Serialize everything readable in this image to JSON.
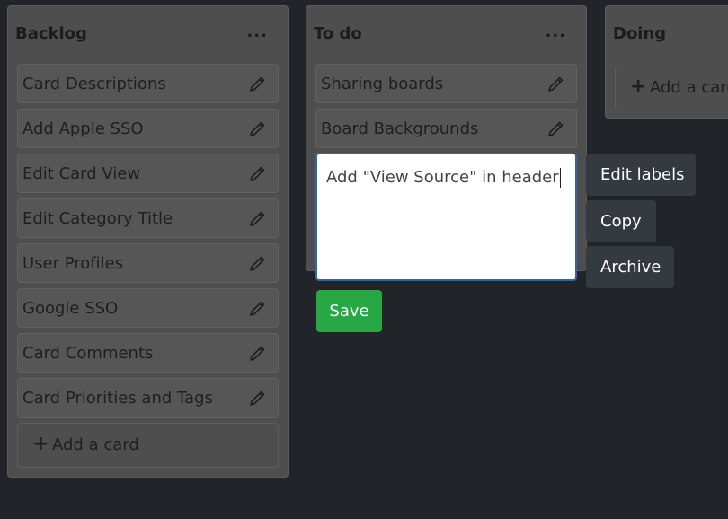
{
  "lists": [
    {
      "title": "Backlog",
      "menu_label": "...",
      "cards": [
        "Card Descriptions",
        "Add Apple SSO",
        "Edit Card View",
        "Edit Category Title",
        "User Profiles",
        "Google SSO",
        "Card Comments",
        "Card Priorities and Tags"
      ],
      "add_card_label": "Add a card"
    },
    {
      "title": "To do",
      "menu_label": "...",
      "cards": [
        "Sharing boards",
        "Board Backgrounds"
      ]
    },
    {
      "title": "Doing",
      "add_card_label": "Add a card"
    }
  ],
  "editor": {
    "text": "Add \"View Source\" in header",
    "save_label": "Save"
  },
  "quick_actions": [
    "Edit labels",
    "Copy",
    "Archive"
  ],
  "icons": {
    "edit": "pencil-icon",
    "add": "plus-icon",
    "menu": "more-horizontal-icon"
  },
  "colors": {
    "save": "#28a745",
    "editor_border": "#2f66a8",
    "action_bg": "#343a40",
    "background": "#212529"
  }
}
